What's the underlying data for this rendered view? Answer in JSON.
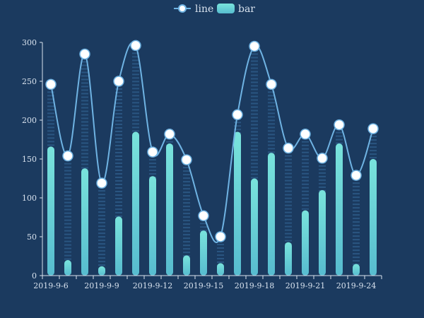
{
  "chart_data": {
    "type": "bar",
    "categories": [
      "2019-9-6",
      "2019-9-7",
      "2019-9-8",
      "2019-9-9",
      "2019-9-10",
      "2019-9-11",
      "2019-9-12",
      "2019-9-13",
      "2019-9-14",
      "2019-9-15",
      "2019-9-16",
      "2019-9-17",
      "2019-9-18",
      "2019-9-19",
      "2019-9-20",
      "2019-9-21",
      "2019-9-22",
      "2019-9-23",
      "2019-9-24",
      "2019-9-25"
    ],
    "x_tick_labels": [
      "2019-9-6",
      "2019-9-9",
      "2019-9-12",
      "2019-9-15",
      "2019-9-18",
      "2019-9-21",
      "2019-9-24"
    ],
    "series": [
      {
        "name": "line",
        "type": "line",
        "smooth": true,
        "values": [
          246,
          154,
          285,
          119,
          250,
          296,
          159,
          182,
          149,
          77,
          50,
          207,
          295,
          246,
          164,
          182,
          151,
          194,
          129,
          189
        ]
      },
      {
        "name": "bar",
        "type": "bar",
        "values": [
          166,
          20,
          138,
          12,
          76,
          185,
          128,
          170,
          26,
          58,
          16,
          185,
          125,
          158,
          43,
          84,
          110,
          170,
          15,
          150
        ]
      }
    ],
    "ylim": [
      0,
      300
    ],
    "yticks": [
      0,
      50,
      100,
      150,
      200,
      250,
      300
    ],
    "legend_position": "top-center",
    "grid": false,
    "colors": {
      "background": "#1b3a5f",
      "line": "#6fb3e3",
      "marker_fill": "#ffffff",
      "bar_top": "#79e3dc",
      "bar_bottom": "#57bccf",
      "axis": "#d8e2ee",
      "dash_bar": "#2f5f8d"
    }
  }
}
